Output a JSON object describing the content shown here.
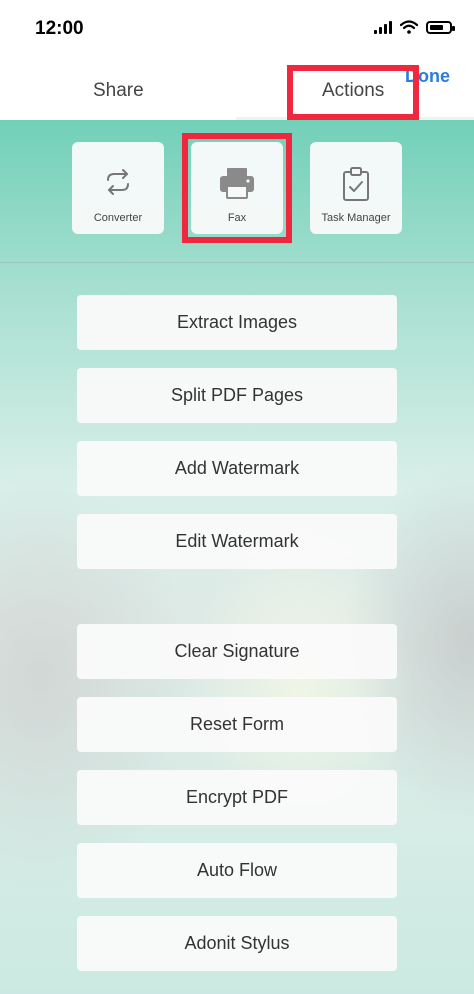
{
  "status_bar": {
    "time": "12:00"
  },
  "tabs": {
    "share_label": "Share",
    "actions_label": "Actions",
    "done_label": "Done"
  },
  "tiles": [
    {
      "label": "Converter",
      "icon": "converter-icon"
    },
    {
      "label": "Fax",
      "icon": "printer-icon"
    },
    {
      "label": "Task Manager",
      "icon": "clipboard-check-icon"
    }
  ],
  "actions": [
    "Extract Images",
    "Split PDF Pages",
    "Add Watermark",
    "Edit Watermark",
    "Clear Signature",
    "Reset Form",
    "Encrypt PDF",
    "Auto Flow",
    "Adonit Stylus"
  ],
  "colors": {
    "highlight": "#ef2840",
    "accent": "#2b7be0",
    "teal": "#72d0b8"
  }
}
